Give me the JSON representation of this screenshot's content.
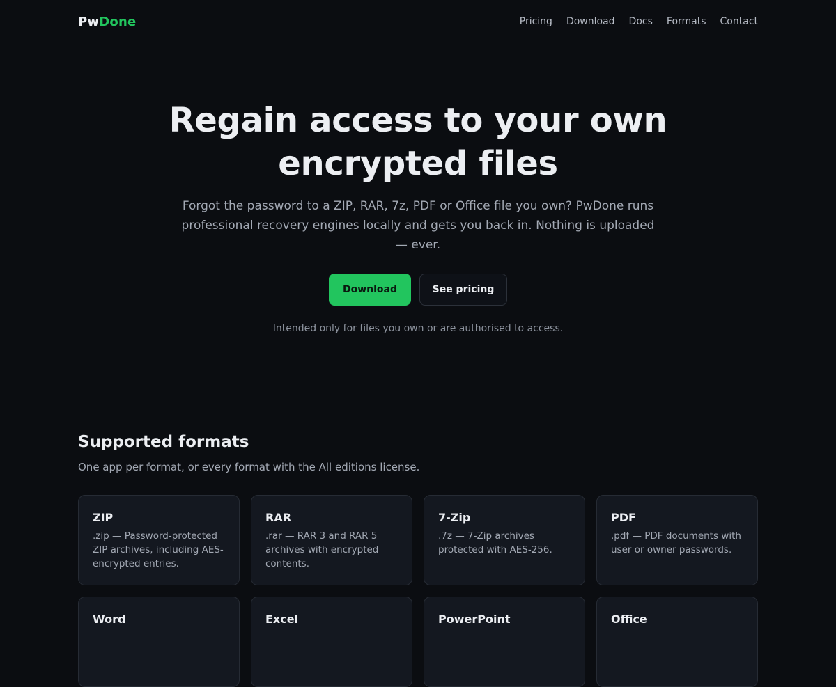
{
  "header": {
    "logo_part1": "Pw",
    "logo_part2": "Done",
    "nav": [
      "Pricing",
      "Download",
      "Docs",
      "Formats",
      "Contact"
    ]
  },
  "hero": {
    "title": "Regain access to your own encrypted files",
    "subtitle": "Forgot the password to a ZIP, RAR, 7z, PDF or Office file you own? PwDone runs professional recovery engines locally and gets you back in. Nothing is uploaded — ever.",
    "download_label": "Download",
    "pricing_label": "See pricing",
    "disclaimer": "Intended only for files you own or are authorised to access."
  },
  "formats": {
    "title": "Supported formats",
    "subtitle": "One app per format, or every format with the All editions license.",
    "cards": [
      {
        "name": "ZIP",
        "desc": ".zip — Password-protected ZIP archives, including AES-encrypted entries."
      },
      {
        "name": "RAR",
        "desc": ".rar — RAR 3 and RAR 5 archives with encrypted contents."
      },
      {
        "name": "7-Zip",
        "desc": ".7z — 7-Zip archives protected with AES-256."
      },
      {
        "name": "PDF",
        "desc": ".pdf — PDF documents with user or owner passwords."
      },
      {
        "name": "Word",
        "desc": ""
      },
      {
        "name": "Excel",
        "desc": ""
      },
      {
        "name": "PowerPoint",
        "desc": ""
      },
      {
        "name": "Office",
        "desc": ""
      }
    ]
  },
  "colors": {
    "background": "#0b0d11",
    "accent": "#22c55e",
    "card_background": "#141820"
  }
}
